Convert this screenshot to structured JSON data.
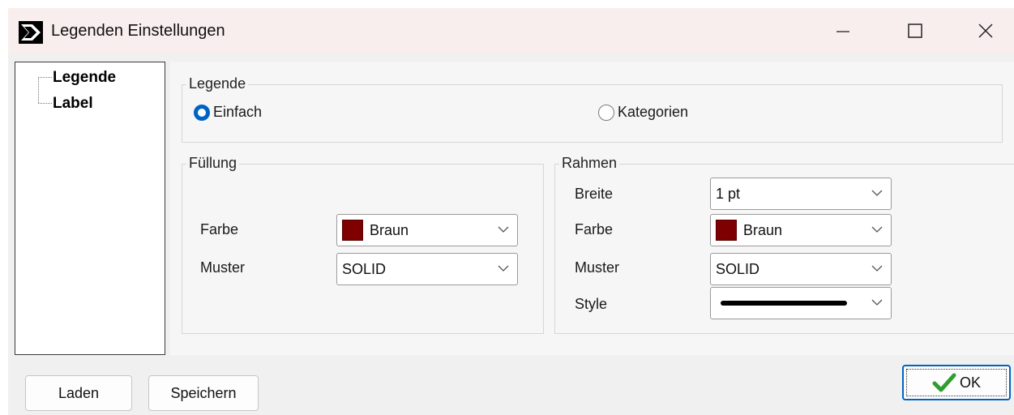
{
  "window": {
    "title": "Legenden Einstellungen",
    "controls": {
      "minimize": "minimize-icon",
      "maximize": "maximize-icon",
      "close": "close-icon"
    }
  },
  "tree": {
    "items": [
      {
        "label": "Legende"
      },
      {
        "label": "Label"
      }
    ]
  },
  "legende": {
    "title": "Legende",
    "options": [
      {
        "label": "Einfach",
        "checked": true
      },
      {
        "label": "Kategorien",
        "checked": false
      }
    ]
  },
  "fuellung": {
    "title": "Füllung",
    "farbe_label": "Farbe",
    "farbe_value": "Braun",
    "farbe_color": "#7f0000",
    "muster_label": "Muster",
    "muster_value": "SOLID"
  },
  "rahmen": {
    "title": "Rahmen",
    "breite_label": "Breite",
    "breite_value": "1 pt",
    "farbe_label": "Farbe",
    "farbe_value": "Braun",
    "farbe_color": "#7f0000",
    "muster_label": "Muster",
    "muster_value": "SOLID",
    "style_label": "Style",
    "style_value": "solid-line"
  },
  "buttons": {
    "laden": "Laden",
    "speichern": "Speichern",
    "ok": "OK"
  },
  "colors": {
    "accent": "#0063c4",
    "titlebar": "#f9eeee",
    "checkmark": "#2e9e2e"
  }
}
